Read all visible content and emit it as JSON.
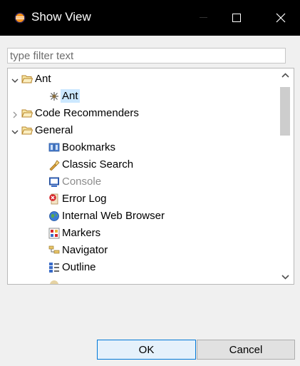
{
  "window": {
    "title": "Show View",
    "controls": [
      "minimize",
      "maximize",
      "close"
    ]
  },
  "filter": {
    "placeholder": "type filter text",
    "value": ""
  },
  "tree": {
    "items": [
      {
        "label": "Ant",
        "icon": "folder-icon",
        "expanded": true
      },
      {
        "label": "Ant",
        "icon": "ant-view-icon",
        "selected": true
      },
      {
        "label": "Code Recommenders",
        "icon": "folder-icon",
        "expanded": false
      },
      {
        "label": "General",
        "icon": "folder-icon",
        "expanded": true
      },
      {
        "label": "Bookmarks",
        "icon": "bookmarks-icon"
      },
      {
        "label": "Classic Search",
        "icon": "search-flashlight-icon"
      },
      {
        "label": "Console",
        "icon": "console-icon",
        "disabled": true
      },
      {
        "label": "Error Log",
        "icon": "error-log-icon"
      },
      {
        "label": "Internal Web Browser",
        "icon": "globe-icon"
      },
      {
        "label": "Markers",
        "icon": "markers-icon"
      },
      {
        "label": "Navigator",
        "icon": "navigator-icon"
      },
      {
        "label": "Outline",
        "icon": "outline-icon"
      }
    ]
  },
  "buttons": {
    "ok": "OK",
    "cancel": "Cancel"
  },
  "colors": {
    "titlebar": "#000000",
    "dialog_bg": "#f0f0f0",
    "selection": "#cce8ff",
    "focus_border": "#0078d7"
  }
}
